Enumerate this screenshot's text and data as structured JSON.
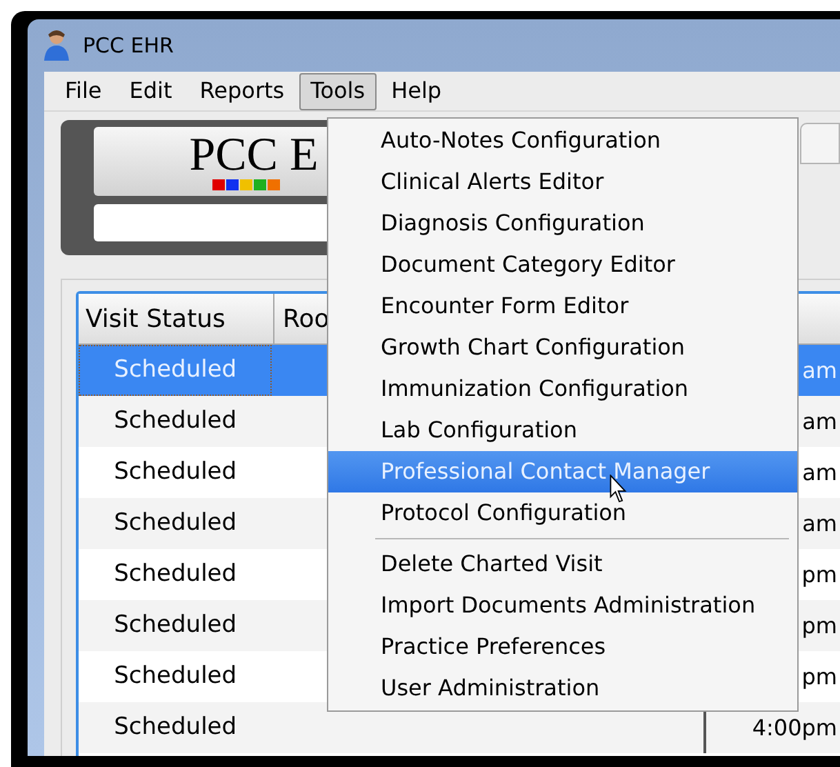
{
  "window": {
    "title": "PCC EHR"
  },
  "menu_bar": [
    {
      "label": "File",
      "selected": false
    },
    {
      "label": "Edit",
      "selected": false
    },
    {
      "label": "Reports",
      "selected": false
    },
    {
      "label": "Tools",
      "selected": true
    },
    {
      "label": "Help",
      "selected": false
    }
  ],
  "logo": {
    "text": "PCC E"
  },
  "table": {
    "columns": [
      "Visit Status",
      "Roo"
    ],
    "rows": [
      {
        "status": "Scheduled",
        "time": "am",
        "selected": true
      },
      {
        "status": "Scheduled",
        "time": "am",
        "selected": false
      },
      {
        "status": "Scheduled",
        "time": "am",
        "selected": false
      },
      {
        "status": "Scheduled",
        "time": "am",
        "selected": false
      },
      {
        "status": "Scheduled",
        "time": "pm",
        "selected": false
      },
      {
        "status": "Scheduled",
        "time": "pm",
        "selected": false
      },
      {
        "status": "Scheduled",
        "time": "pm",
        "selected": false
      },
      {
        "status": "Scheduled",
        "time": "4:00pm",
        "selected": false
      }
    ]
  },
  "tools_menu": [
    {
      "kind": "item",
      "label": "Auto-Notes Configuration",
      "selected": false
    },
    {
      "kind": "item",
      "label": "Clinical Alerts Editor",
      "selected": false
    },
    {
      "kind": "item",
      "label": "Diagnosis Configuration",
      "selected": false
    },
    {
      "kind": "item",
      "label": "Document Category Editor",
      "selected": false
    },
    {
      "kind": "item",
      "label": "Encounter Form Editor",
      "selected": false
    },
    {
      "kind": "item",
      "label": "Growth Chart Configuration",
      "selected": false
    },
    {
      "kind": "item",
      "label": "Immunization Configuration",
      "selected": false
    },
    {
      "kind": "item",
      "label": "Lab Configuration",
      "selected": false
    },
    {
      "kind": "item",
      "label": "Professional Contact Manager",
      "selected": true
    },
    {
      "kind": "item",
      "label": "Protocol Configuration",
      "selected": false
    },
    {
      "kind": "separator"
    },
    {
      "kind": "item",
      "label": "Delete Charted Visit",
      "selected": false
    },
    {
      "kind": "item",
      "label": "Import Documents Administration",
      "selected": false
    },
    {
      "kind": "item",
      "label": "Practice Preferences",
      "selected": false
    },
    {
      "kind": "item",
      "label": "User Administration",
      "selected": false
    }
  ]
}
